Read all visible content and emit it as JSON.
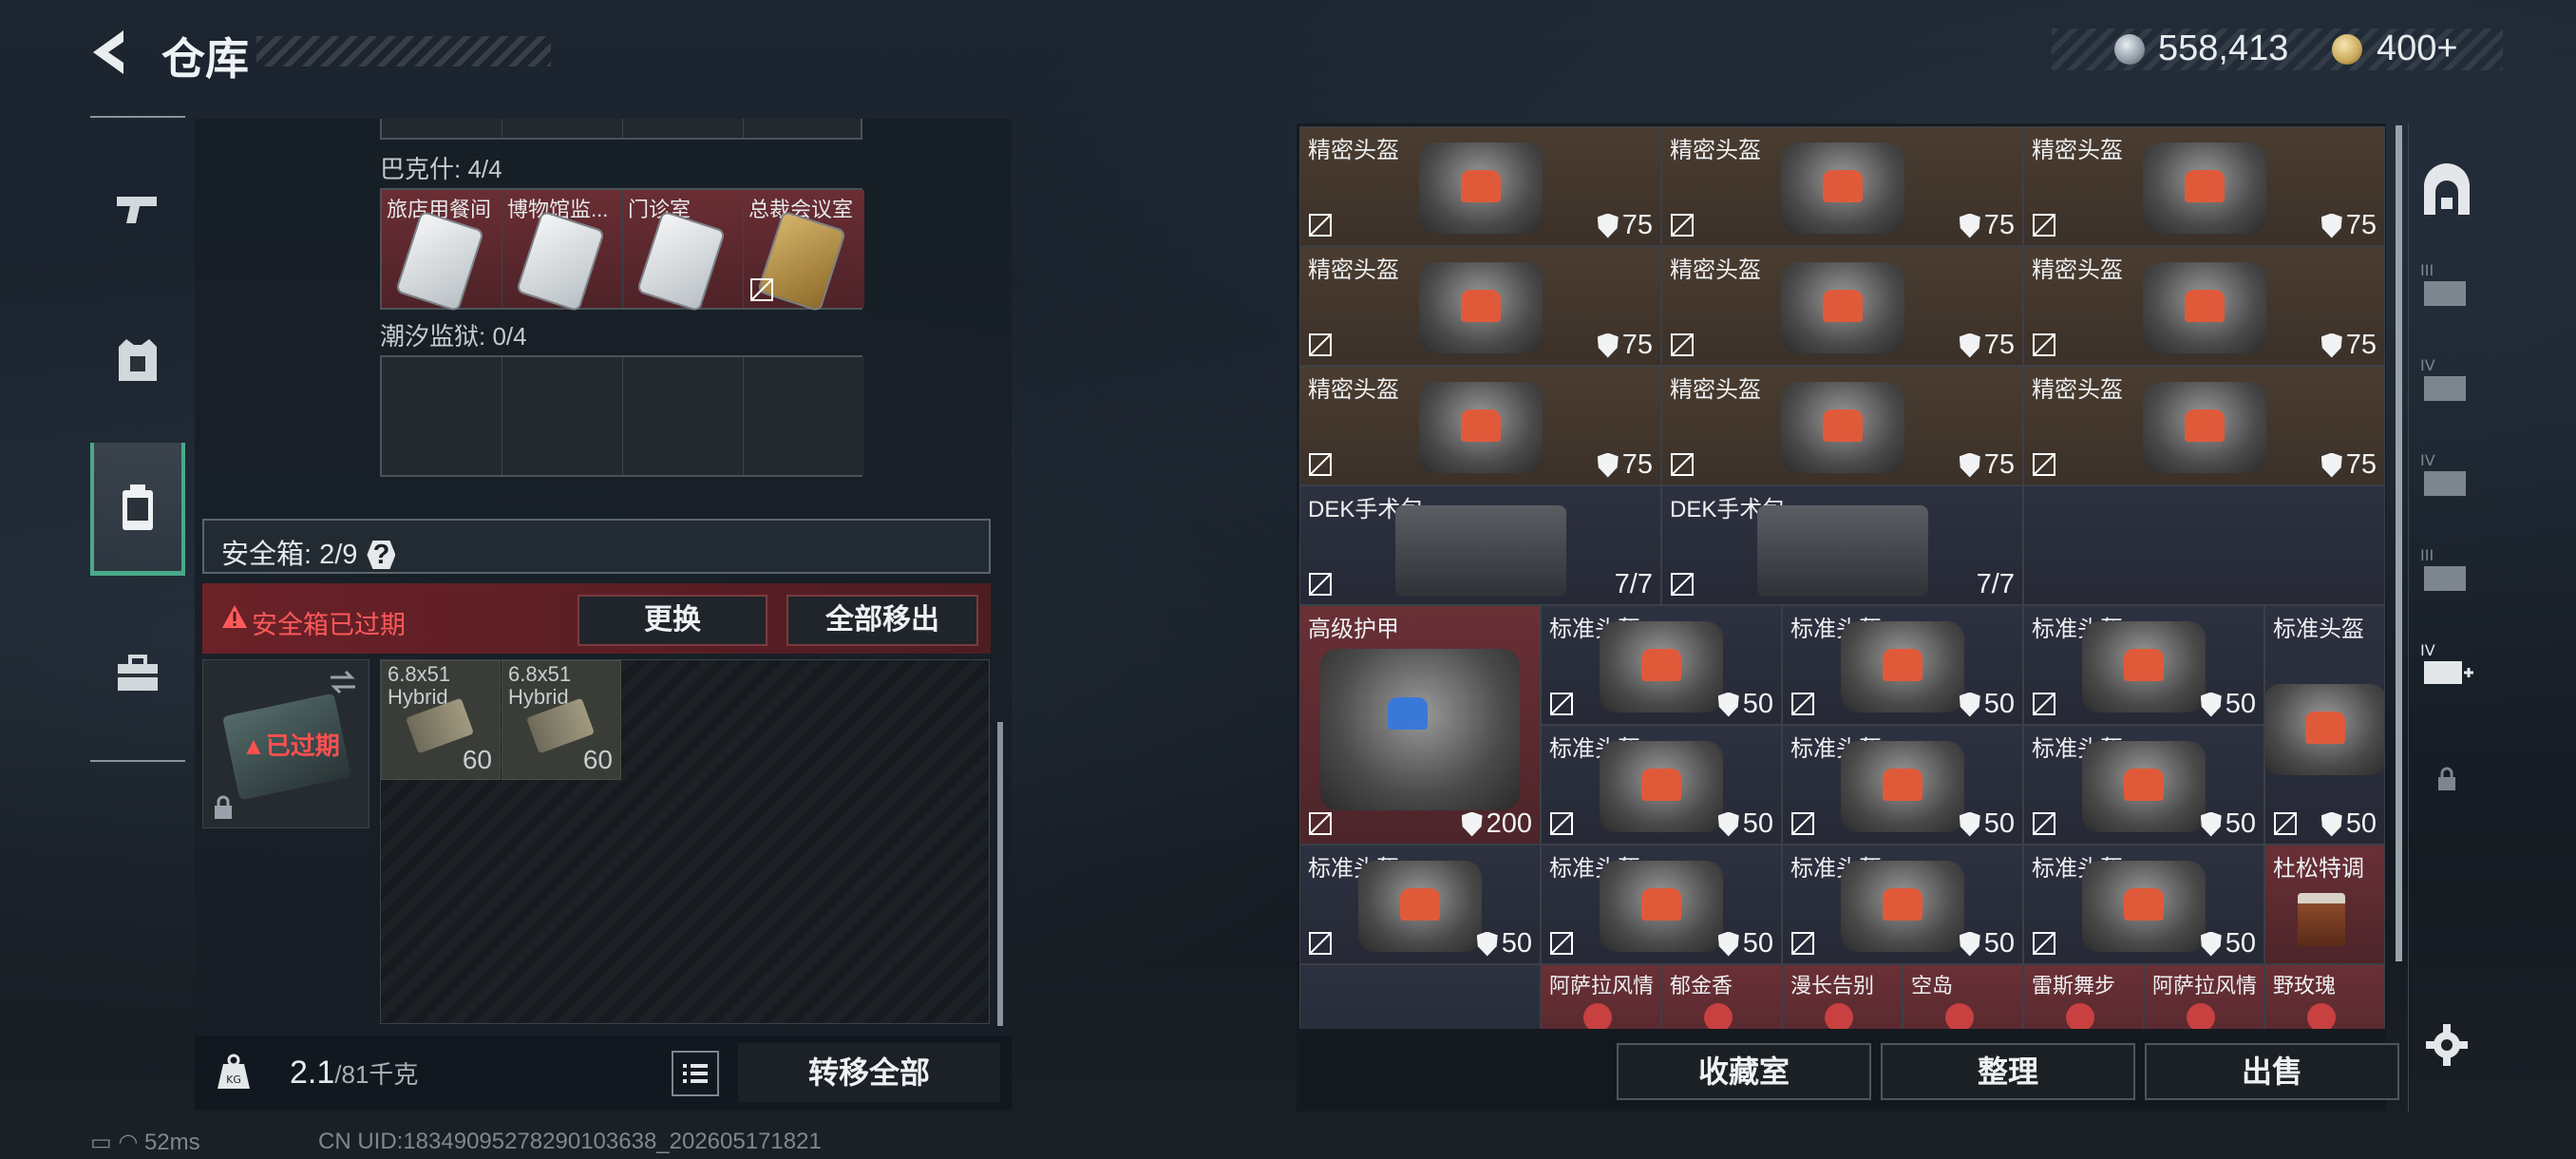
{
  "header": {
    "title": "仓库",
    "currency_silver": "558,413",
    "currency_gold": "400+"
  },
  "left_rail": {
    "items": [
      {
        "name": "weapons-tab",
        "icon": "pistol-icon"
      },
      {
        "name": "gear-tab",
        "icon": "vest-icon"
      },
      {
        "name": "container-tab",
        "icon": "case-icon"
      },
      {
        "name": "toolbox-tab",
        "icon": "toolbox-icon"
      }
    ]
  },
  "keycards": {
    "set1_label": "巴克什: 4/4",
    "set1_cards": [
      "旅店用餐间",
      "博物馆监...",
      "门诊室",
      "总裁会议室"
    ],
    "set2_label": "潮汐监狱: 0/4"
  },
  "safebox": {
    "label": "安全箱: 2/9",
    "expired_warning": "安全箱已过期",
    "replace_button": "更换",
    "move_all_button": "全部移出",
    "case_status": "已过期",
    "ammo": [
      {
        "caliber": "6.8x51",
        "type": "Hybrid",
        "count": "60"
      },
      {
        "caliber": "6.8x51",
        "type": "Hybrid",
        "count": "60"
      }
    ]
  },
  "footer_left": {
    "weight": "2.1",
    "capacity": "/81千克",
    "transfer_all": "转移全部"
  },
  "status_bar": {
    "ping": "52ms",
    "uid": "CN UID:1834909527829010363​8_202605171821"
  },
  "inventory": {
    "rows_precision": [
      {
        "name": "精密头盔",
        "value": "75"
      },
      {
        "name": "精密头盔",
        "value": "75"
      },
      {
        "name": "精密头盔",
        "value": "75"
      },
      {
        "name": "精密头盔",
        "value": "75"
      },
      {
        "name": "精密头盔",
        "value": "75"
      },
      {
        "name": "精密头盔",
        "value": "75"
      },
      {
        "name": "精密头盔",
        "value": "75"
      },
      {
        "name": "精密头盔",
        "value": "75"
      },
      {
        "name": "精密头盔",
        "value": "75"
      }
    ],
    "medkits": [
      {
        "name": "DEK手术包",
        "value": "7/7"
      },
      {
        "name": "DEK手术包",
        "value": "7/7"
      }
    ],
    "armor": {
      "name": "高级护甲",
      "value": "200"
    },
    "standard_helmets": [
      {
        "name": "标准头盔",
        "value": "50"
      },
      {
        "name": "标准头盔",
        "value": "50"
      },
      {
        "name": "标准头盔",
        "value": "50"
      },
      {
        "name": "标准头盔",
        "value": "50"
      },
      {
        "name": "标准头盔",
        "value": "50"
      },
      {
        "name": "标准头盔",
        "value": "50"
      },
      {
        "name": "标准头盔",
        "value": "50"
      },
      {
        "name": "标准头盔",
        "value": "50"
      },
      {
        "name": "标准头盔",
        "value": "50"
      },
      {
        "name": "标准头盔",
        "value": "50"
      },
      {
        "name": "标准头盔",
        "value": "50"
      }
    ],
    "special_drink": "杜松特调",
    "drinks": [
      "阿萨拉风情",
      "郁金香",
      "漫长告别",
      "空岛",
      "雷斯舞步",
      "阿萨拉风情",
      "野玫瑰"
    ],
    "buttons": {
      "collection": "收藏室",
      "sort": "整理",
      "sell": "出售"
    }
  },
  "colors": {
    "accent": "#4aa98a",
    "danger": "#ff5a5a",
    "brown_cell": "#4a3c30",
    "navy_cell": "#2d3140"
  }
}
